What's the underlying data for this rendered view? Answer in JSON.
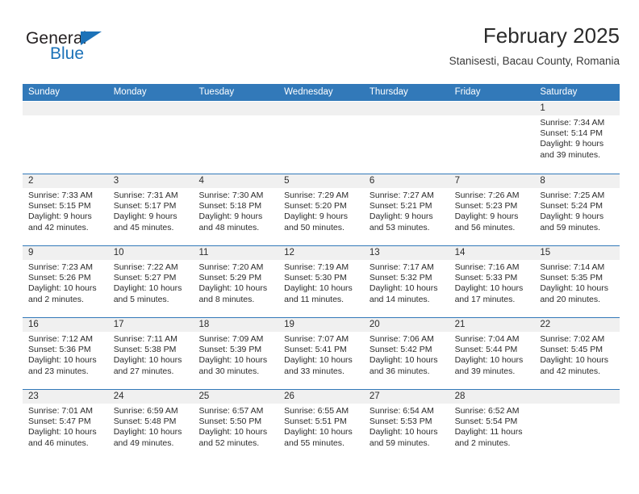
{
  "brand": {
    "name_dark": "General",
    "name_blue": "Blue",
    "accent_color": "#1c72b8"
  },
  "header": {
    "title": "February 2025",
    "subtitle": "Stanisesti, Bacau County, Romania"
  },
  "theme": {
    "header_blue": "#3279b9",
    "day_band_gray": "#f0f0f0",
    "text_color": "#2b2b2b"
  },
  "weekdays": [
    "Sunday",
    "Monday",
    "Tuesday",
    "Wednesday",
    "Thursday",
    "Friday",
    "Saturday"
  ],
  "weeks": [
    [
      {
        "day": "",
        "empty": true
      },
      {
        "day": "",
        "empty": true
      },
      {
        "day": "",
        "empty": true
      },
      {
        "day": "",
        "empty": true
      },
      {
        "day": "",
        "empty": true
      },
      {
        "day": "",
        "empty": true
      },
      {
        "day": "1",
        "sunrise": "Sunrise: 7:34 AM",
        "sunset": "Sunset: 5:14 PM",
        "daylight1": "Daylight: 9 hours",
        "daylight2": "and 39 minutes."
      }
    ],
    [
      {
        "day": "2",
        "sunrise": "Sunrise: 7:33 AM",
        "sunset": "Sunset: 5:15 PM",
        "daylight1": "Daylight: 9 hours",
        "daylight2": "and 42 minutes."
      },
      {
        "day": "3",
        "sunrise": "Sunrise: 7:31 AM",
        "sunset": "Sunset: 5:17 PM",
        "daylight1": "Daylight: 9 hours",
        "daylight2": "and 45 minutes."
      },
      {
        "day": "4",
        "sunrise": "Sunrise: 7:30 AM",
        "sunset": "Sunset: 5:18 PM",
        "daylight1": "Daylight: 9 hours",
        "daylight2": "and 48 minutes."
      },
      {
        "day": "5",
        "sunrise": "Sunrise: 7:29 AM",
        "sunset": "Sunset: 5:20 PM",
        "daylight1": "Daylight: 9 hours",
        "daylight2": "and 50 minutes."
      },
      {
        "day": "6",
        "sunrise": "Sunrise: 7:27 AM",
        "sunset": "Sunset: 5:21 PM",
        "daylight1": "Daylight: 9 hours",
        "daylight2": "and 53 minutes."
      },
      {
        "day": "7",
        "sunrise": "Sunrise: 7:26 AM",
        "sunset": "Sunset: 5:23 PM",
        "daylight1": "Daylight: 9 hours",
        "daylight2": "and 56 minutes."
      },
      {
        "day": "8",
        "sunrise": "Sunrise: 7:25 AM",
        "sunset": "Sunset: 5:24 PM",
        "daylight1": "Daylight: 9 hours",
        "daylight2": "and 59 minutes."
      }
    ],
    [
      {
        "day": "9",
        "sunrise": "Sunrise: 7:23 AM",
        "sunset": "Sunset: 5:26 PM",
        "daylight1": "Daylight: 10 hours",
        "daylight2": "and 2 minutes."
      },
      {
        "day": "10",
        "sunrise": "Sunrise: 7:22 AM",
        "sunset": "Sunset: 5:27 PM",
        "daylight1": "Daylight: 10 hours",
        "daylight2": "and 5 minutes."
      },
      {
        "day": "11",
        "sunrise": "Sunrise: 7:20 AM",
        "sunset": "Sunset: 5:29 PM",
        "daylight1": "Daylight: 10 hours",
        "daylight2": "and 8 minutes."
      },
      {
        "day": "12",
        "sunrise": "Sunrise: 7:19 AM",
        "sunset": "Sunset: 5:30 PM",
        "daylight1": "Daylight: 10 hours",
        "daylight2": "and 11 minutes."
      },
      {
        "day": "13",
        "sunrise": "Sunrise: 7:17 AM",
        "sunset": "Sunset: 5:32 PM",
        "daylight1": "Daylight: 10 hours",
        "daylight2": "and 14 minutes."
      },
      {
        "day": "14",
        "sunrise": "Sunrise: 7:16 AM",
        "sunset": "Sunset: 5:33 PM",
        "daylight1": "Daylight: 10 hours",
        "daylight2": "and 17 minutes."
      },
      {
        "day": "15",
        "sunrise": "Sunrise: 7:14 AM",
        "sunset": "Sunset: 5:35 PM",
        "daylight1": "Daylight: 10 hours",
        "daylight2": "and 20 minutes."
      }
    ],
    [
      {
        "day": "16",
        "sunrise": "Sunrise: 7:12 AM",
        "sunset": "Sunset: 5:36 PM",
        "daylight1": "Daylight: 10 hours",
        "daylight2": "and 23 minutes."
      },
      {
        "day": "17",
        "sunrise": "Sunrise: 7:11 AM",
        "sunset": "Sunset: 5:38 PM",
        "daylight1": "Daylight: 10 hours",
        "daylight2": "and 27 minutes."
      },
      {
        "day": "18",
        "sunrise": "Sunrise: 7:09 AM",
        "sunset": "Sunset: 5:39 PM",
        "daylight1": "Daylight: 10 hours",
        "daylight2": "and 30 minutes."
      },
      {
        "day": "19",
        "sunrise": "Sunrise: 7:07 AM",
        "sunset": "Sunset: 5:41 PM",
        "daylight1": "Daylight: 10 hours",
        "daylight2": "and 33 minutes."
      },
      {
        "day": "20",
        "sunrise": "Sunrise: 7:06 AM",
        "sunset": "Sunset: 5:42 PM",
        "daylight1": "Daylight: 10 hours",
        "daylight2": "and 36 minutes."
      },
      {
        "day": "21",
        "sunrise": "Sunrise: 7:04 AM",
        "sunset": "Sunset: 5:44 PM",
        "daylight1": "Daylight: 10 hours",
        "daylight2": "and 39 minutes."
      },
      {
        "day": "22",
        "sunrise": "Sunrise: 7:02 AM",
        "sunset": "Sunset: 5:45 PM",
        "daylight1": "Daylight: 10 hours",
        "daylight2": "and 42 minutes."
      }
    ],
    [
      {
        "day": "23",
        "sunrise": "Sunrise: 7:01 AM",
        "sunset": "Sunset: 5:47 PM",
        "daylight1": "Daylight: 10 hours",
        "daylight2": "and 46 minutes."
      },
      {
        "day": "24",
        "sunrise": "Sunrise: 6:59 AM",
        "sunset": "Sunset: 5:48 PM",
        "daylight1": "Daylight: 10 hours",
        "daylight2": "and 49 minutes."
      },
      {
        "day": "25",
        "sunrise": "Sunrise: 6:57 AM",
        "sunset": "Sunset: 5:50 PM",
        "daylight1": "Daylight: 10 hours",
        "daylight2": "and 52 minutes."
      },
      {
        "day": "26",
        "sunrise": "Sunrise: 6:55 AM",
        "sunset": "Sunset: 5:51 PM",
        "daylight1": "Daylight: 10 hours",
        "daylight2": "and 55 minutes."
      },
      {
        "day": "27",
        "sunrise": "Sunrise: 6:54 AM",
        "sunset": "Sunset: 5:53 PM",
        "daylight1": "Daylight: 10 hours",
        "daylight2": "and 59 minutes."
      },
      {
        "day": "28",
        "sunrise": "Sunrise: 6:52 AM",
        "sunset": "Sunset: 5:54 PM",
        "daylight1": "Daylight: 11 hours",
        "daylight2": "and 2 minutes."
      },
      {
        "day": "",
        "empty": true
      }
    ]
  ]
}
